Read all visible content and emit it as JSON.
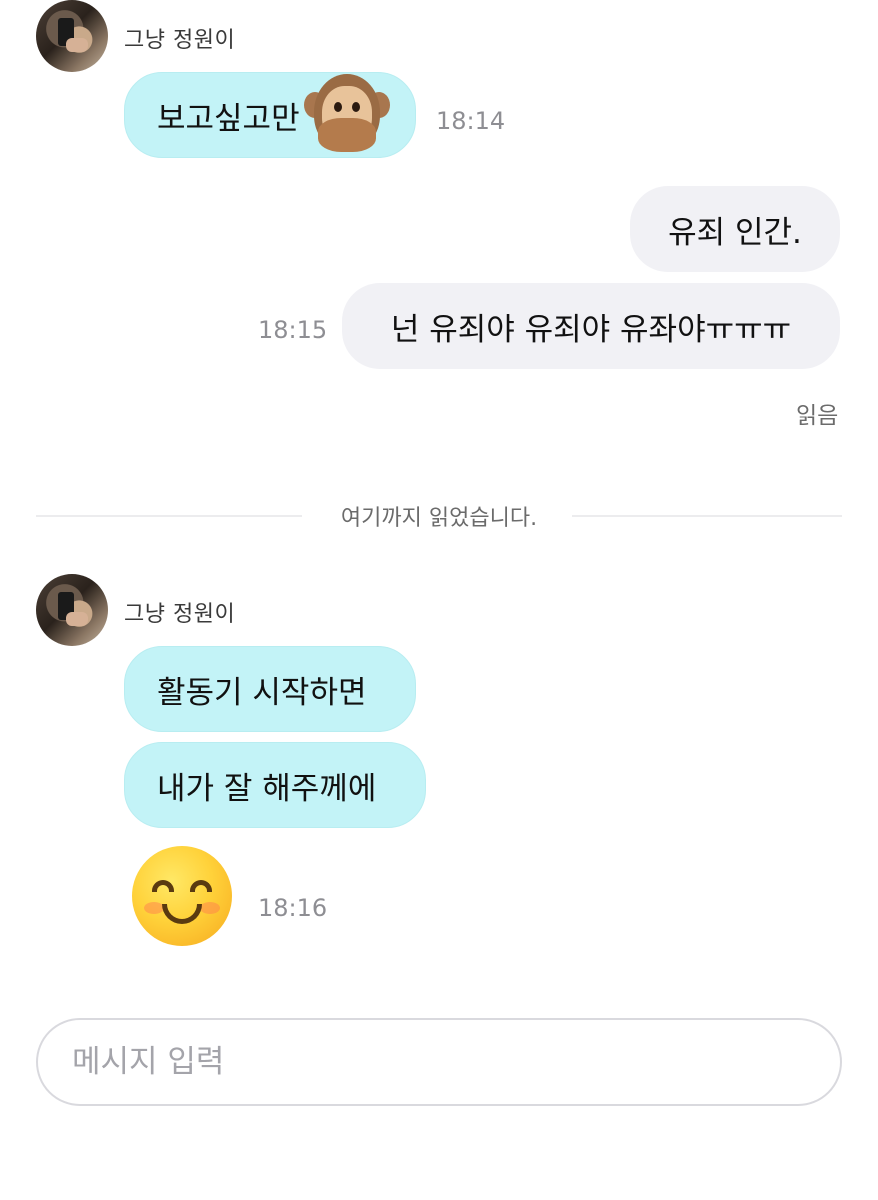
{
  "chat": {
    "sender_name": "그냥 정원이",
    "messages": [
      {
        "text": "보고싶고만",
        "emoji": "see-no-evil-monkey",
        "time": "18:14"
      },
      {
        "text": "유죄 인간."
      },
      {
        "text": "넌 유죄야 유죄야 유좌야ㅠㅠㅠ",
        "time": "18:15"
      },
      {
        "text": "활동기 시작하면"
      },
      {
        "text": "내가 잘 해주께에"
      },
      {
        "emoji": "smiling-face-with-smiling-eyes",
        "time": "18:16"
      }
    ],
    "read_status": "읽음",
    "divider": "여기까지 읽었습니다.",
    "colors": {
      "incoming_bubble": "#c3f3f7",
      "outgoing_bubble": "#f1f1f5"
    }
  },
  "input": {
    "placeholder": "메시지 입력"
  }
}
